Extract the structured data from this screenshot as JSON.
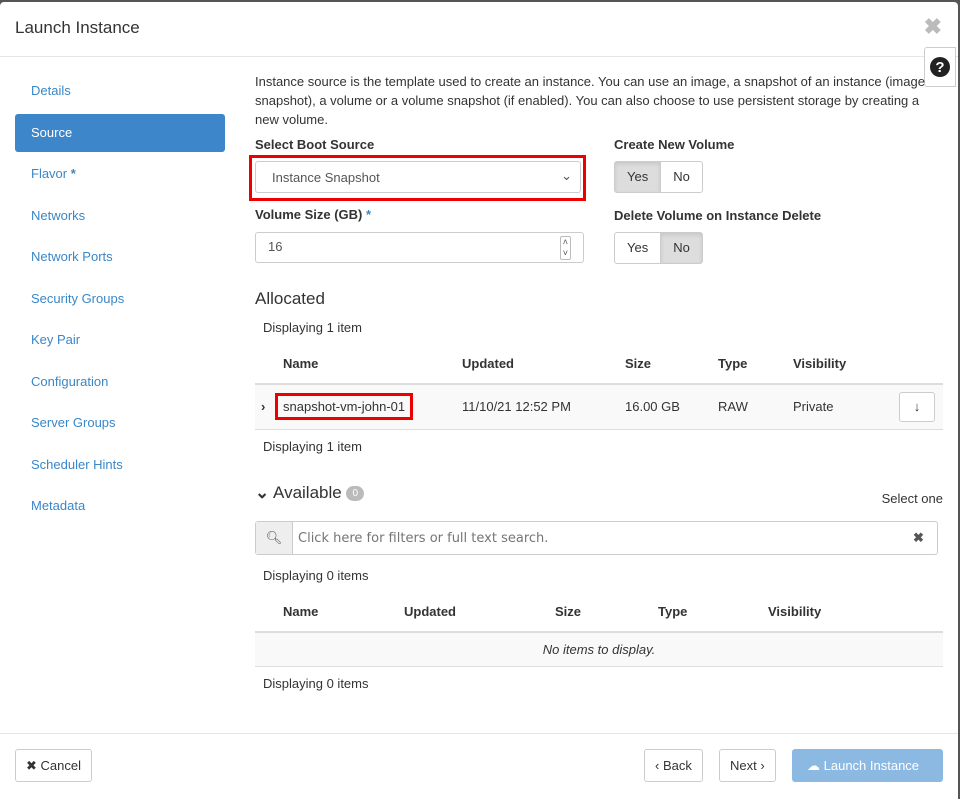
{
  "title": "Launch Instance",
  "sidebar": {
    "items": [
      {
        "label": "Details"
      },
      {
        "label": "Source"
      },
      {
        "label": "Flavor",
        "required": "*"
      },
      {
        "label": "Networks"
      },
      {
        "label": "Network Ports"
      },
      {
        "label": "Security Groups"
      },
      {
        "label": "Key Pair"
      },
      {
        "label": "Configuration"
      },
      {
        "label": "Server Groups"
      },
      {
        "label": "Scheduler Hints"
      },
      {
        "label": "Metadata"
      }
    ]
  },
  "intro": "Instance source is the template used to create an instance. You can use an image, a snapshot of an instance (image snapshot), a volume or a volume snapshot (if enabled). You can also choose to use persistent storage by creating a new volume.",
  "boot": {
    "label": "Select Boot Source",
    "value": "Instance Snapshot"
  },
  "volume_size": {
    "label": "Volume Size (GB)",
    "required": "*",
    "value": "16"
  },
  "create_volume": {
    "label": "Create New Volume",
    "yes": "Yes",
    "no": "No",
    "selected": "Yes"
  },
  "delete_volume": {
    "label": "Delete Volume on Instance Delete",
    "yes": "Yes",
    "no": "No",
    "selected": "No"
  },
  "allocated": {
    "title": "Allocated",
    "count_top": "Displaying 1 item",
    "count_bottom": "Displaying 1 item",
    "columns": [
      "Name",
      "Updated",
      "Size",
      "Type",
      "Visibility"
    ],
    "rows": [
      {
        "name": "snapshot-vm-john-01",
        "updated": "11/10/21 12:52 PM",
        "size": "16.00 GB",
        "type": "RAW",
        "visibility": "Private"
      }
    ]
  },
  "available": {
    "title": "Available",
    "badge": "0",
    "select_hint": "Select one",
    "search_placeholder": "Click here for filters or full text search.",
    "count_top": "Displaying 0 items",
    "count_bottom": "Displaying 0 items",
    "columns": [
      "Name",
      "Updated",
      "Size",
      "Type",
      "Visibility"
    ],
    "empty": "No items to display."
  },
  "footer": {
    "cancel": "Cancel",
    "back": "Back",
    "next": "Next",
    "launch": "Launch Instance"
  },
  "colors": {
    "accent": "#3d86c9",
    "highlight": "#e00000"
  }
}
